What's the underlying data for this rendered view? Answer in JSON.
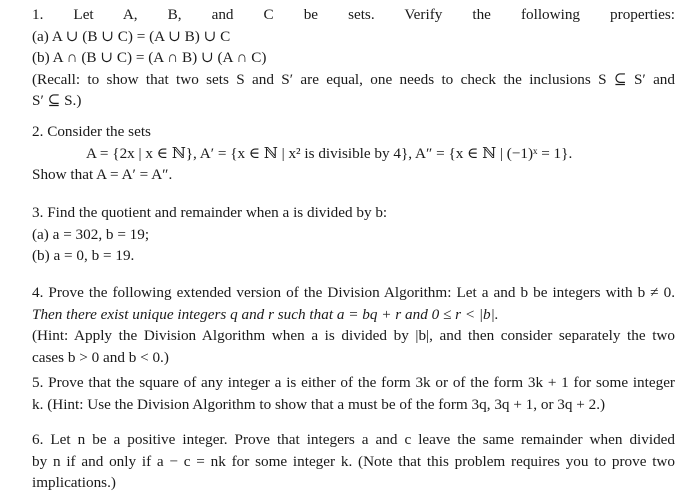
{
  "problems": [
    {
      "number": "1.",
      "lines": [
        "1. Let A, B, and C be sets. Verify the following properties:",
        "(a) A ∪ (B ∪ C) = (A ∪ B) ∪ C",
        "(b) A ∩ (B ∪ C) = (A ∩ B) ∪ (A ∩ C)",
        "(Recall: to show that two sets S and S′ are equal, one needs to check the inclusions S ⊆ S′ and",
        "S′ ⊆ S.)"
      ]
    },
    {
      "number": "2.",
      "lines": [
        "2. Consider the sets",
        "A = {2x | x ∈ ℕ},   A′ = {x ∈ ℕ | x² is divisible by 4},   A″ = {x ∈ ℕ | (−1)ˣ = 1}.",
        "Show that A = A′ = A″."
      ]
    },
    {
      "number": "3.",
      "lines": [
        "3. Find the quotient and remainder when a is divided by b:",
        "(a) a = 302, b = 19;",
        "(b) a = 0, b = 19."
      ]
    },
    {
      "number": "4.",
      "lines": [
        "4. Prove the following extended version of the Division Algorithm: Let a and b be integers with b ≠ 0.",
        "Then there exist unique integers q and r such that a = bq + r and 0 ≤ r < |b|.",
        "(Hint: Apply the Division Algorithm when a is divided by |b|, and then consider separately the two",
        "cases b > 0 and b < 0.)"
      ]
    },
    {
      "number": "5.",
      "lines": [
        "5. Prove that the square of any integer a is either of the form 3k or of the form 3k + 1 for some integer",
        "k. (Hint: Use the Division Algorithm to show that a must be of the form 3q, 3q + 1, or 3q + 2.)"
      ]
    },
    {
      "number": "6.",
      "lines": [
        "6. Let n be a positive integer. Prove that integers a and c leave the same remainder when divided",
        "by n if and only if a − c = nk for some integer k. (Note that this problem requires you to prove two",
        "implications.)"
      ]
    }
  ]
}
